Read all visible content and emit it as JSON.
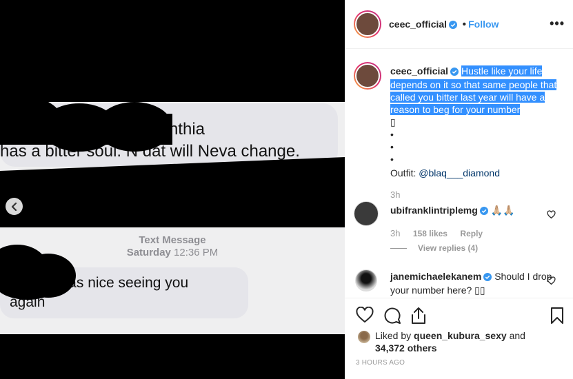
{
  "post": {
    "username": "ceec_official",
    "follow_label": "Follow",
    "more_label": "•••",
    "caption_text": "Hustle like your life depends on it so that same people that called you bitter last year will have a reason to beg for your number",
    "caption_emoji": "▯",
    "caption_dots": [
      "•",
      "•",
      "•"
    ],
    "outfit_label": "Outfit: ",
    "outfit_mention": "@blaq___diamond",
    "caption_time": "3h"
  },
  "media": {
    "bubble1_text": "          . We all know Cynthia\nhas a bitter soul. N dat will Neva change.",
    "label_title": "Text Message",
    "label_day": "Saturday",
    "label_time": "12:36 PM",
    "bubble2_text": "       . It was nice seeing you\nagain"
  },
  "comments": [
    {
      "username": "ubifranklintriplemg",
      "text": "🙏🏼🙏🏼",
      "time": "3h",
      "likes": "158 likes",
      "reply_label": "Reply",
      "view_replies": "View replies (4)"
    },
    {
      "username": "janemichaelekanem",
      "text": "Should I drop your number here? ▯▯"
    }
  ],
  "likes": {
    "prefix": "Liked by",
    "user": "queen_kubura_sexy",
    "and": "and",
    "count": "34,372 others"
  },
  "time_ago": "3 HOURS AGO",
  "colors": {
    "link": "#3897f0",
    "verified": "#3897f0",
    "selection": "#3390ff"
  }
}
